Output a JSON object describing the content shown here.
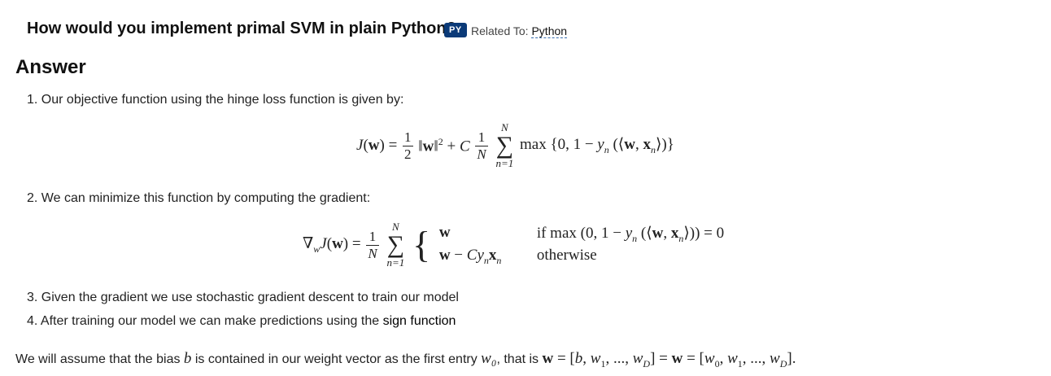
{
  "question": {
    "title": "How would you implement primal SVM in plain Python?",
    "badge": "PY",
    "related_prefix": "Related To:",
    "related_link": "Python"
  },
  "answer_heading": "Answer",
  "steps": [
    {
      "num": "1.",
      "text": "Our objective function using the hinge loss function is given by:"
    },
    {
      "num": "2.",
      "text": "We can minimize this function by computing the gradient:"
    },
    {
      "num": "3.",
      "text": "Given the gradient we use stochastic gradient descent to train our model"
    },
    {
      "num": "4.",
      "text_before": "After training our model we can make predictions using the",
      "strong": "sign function"
    }
  ],
  "equation1": {
    "lhs": "J(w) =",
    "half_num": "1",
    "half_den": "2",
    "norm": "||w||² + C",
    "one_num": "1",
    "one_den": "N",
    "sum_upper": "N",
    "sum_lower": "n=1",
    "rhs": "max {0, 1 − yₙ (⟨w, xₙ⟩)}"
  },
  "equation2": {
    "lhs": "∇wJ(w) =",
    "frac_num": "1",
    "frac_den": "N",
    "sum_upper": "N",
    "sum_lower": "n=1",
    "case1_expr": "w",
    "case1_cond": "if max (0, 1 − yₙ (⟨w, xₙ⟩)) = 0",
    "case2_expr": "w − Cyₙxₙ",
    "case2_cond": "otherwise"
  },
  "footer": {
    "text_before": "We will assume that the bias",
    "bias_symbol": "b",
    "text_middle": "is contained in our weight vector as the first entry",
    "w0_symbol": "w₀",
    "text_after": ", that is",
    "expression": "w = [b, w₁, ..., w_D] = w = [w₀, w₁, ..., w_D]."
  }
}
